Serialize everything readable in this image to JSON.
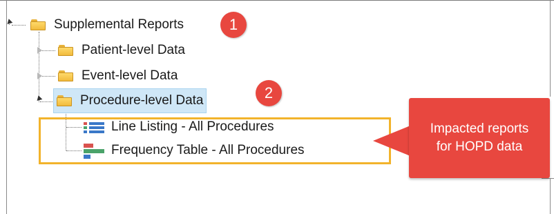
{
  "tree": {
    "root": {
      "label": "Supplemental Reports",
      "expanded": true,
      "icon": "folder-icon"
    },
    "children": [
      {
        "label": "Patient-level Data",
        "expanded": false,
        "icon": "folder-icon"
      },
      {
        "label": "Event-level Data",
        "expanded": false,
        "icon": "folder-icon"
      },
      {
        "label": "Procedure-level Data",
        "expanded": true,
        "selected": true,
        "icon": "folder-icon"
      }
    ],
    "reports": [
      {
        "label": "Line Listing - All Procedures",
        "icon": "line-listing-icon"
      },
      {
        "label": "Frequency Table - All Procedures",
        "icon": "frequency-table-icon"
      }
    ]
  },
  "annotations": {
    "badge_1": "1",
    "badge_2": "2",
    "callout_line1": "Impacted reports",
    "callout_line2": "for HOPD data"
  },
  "colors": {
    "badge": "#e8473f",
    "highlight_border": "#f2b32b",
    "selection_bg": "#cfe7f7"
  }
}
